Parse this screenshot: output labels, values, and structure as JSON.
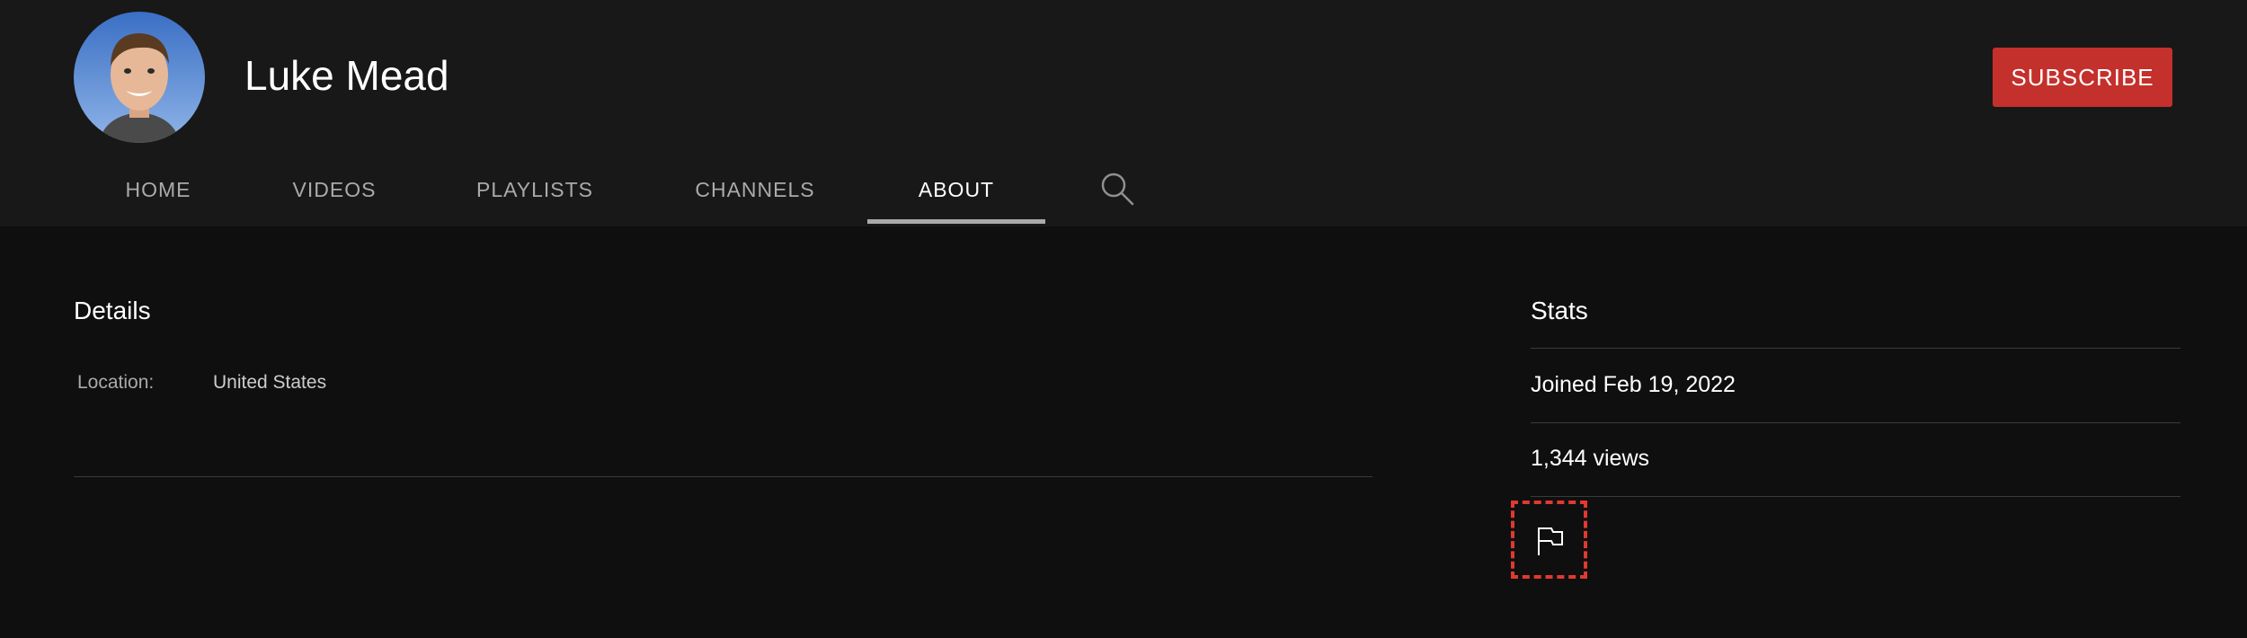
{
  "channel": {
    "name": "Luke Mead",
    "subscribe_label": "SUBSCRIBE"
  },
  "tabs": [
    {
      "label": "HOME"
    },
    {
      "label": "VIDEOS"
    },
    {
      "label": "PLAYLISTS"
    },
    {
      "label": "CHANNELS"
    },
    {
      "label": "ABOUT",
      "active": true
    }
  ],
  "details": {
    "title": "Details",
    "location_label": "Location:",
    "location_value": "United States"
  },
  "stats": {
    "title": "Stats",
    "joined": "Joined Feb 19, 2022",
    "views": "1,344 views"
  },
  "icons": {
    "search": "search-icon",
    "report": "flag-icon"
  },
  "colors": {
    "header_bg": "#181818",
    "page_bg": "#0f0f0f",
    "subscribe_red": "#c4302b",
    "highlight_box": "#e0392f"
  }
}
